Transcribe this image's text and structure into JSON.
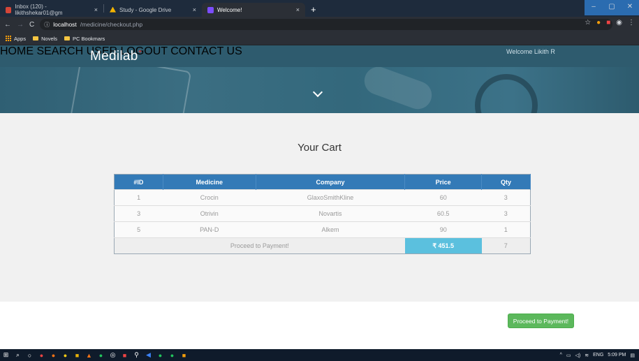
{
  "browser": {
    "tabs": [
      {
        "title": "Inbox (120) - likithshekar01@gm",
        "icon": "gmail-icon",
        "color": "#d44638"
      },
      {
        "title": "Study - Google Drive",
        "icon": "drive-icon",
        "color": "#f4b400"
      },
      {
        "title": "Welcome!",
        "icon": "page-icon",
        "color": "#7c4dff"
      }
    ],
    "new_tab": "+",
    "url_host": "localhost",
    "url_path": "/medicine/checkout.php",
    "bookmarks": [
      "Apps",
      "Novels",
      "PC Bookmars"
    ]
  },
  "site": {
    "logo": "Medilab",
    "logo_mark": "+",
    "nav": [
      "HOME",
      "SEARCH",
      "USER",
      "LOGOUT",
      "CONTACT US"
    ],
    "welcome": "Welcome Likith R"
  },
  "cart": {
    "title": "Your Cart",
    "headers": [
      "#ID",
      "Medicine",
      "Company",
      "Price",
      "Qty"
    ],
    "rows": [
      {
        "id": "1",
        "medicine": "Crocin",
        "company": "GlaxoSmithKline",
        "price": "60",
        "qty": "3"
      },
      {
        "id": "3",
        "medicine": "Otrivin",
        "company": "Novartis",
        "price": "60.5",
        "qty": "3"
      },
      {
        "id": "5",
        "medicine": "PAN-D",
        "company": "Alkem",
        "price": "90",
        "qty": "1"
      }
    ],
    "footer_label": "Proceed to Payment!",
    "total": "₹ 451.5",
    "total_qty": "7"
  },
  "button": {
    "label": "Proceed to Payment!"
  },
  "taskbar": {
    "lang": "ENG",
    "time": "5:09 PM"
  }
}
